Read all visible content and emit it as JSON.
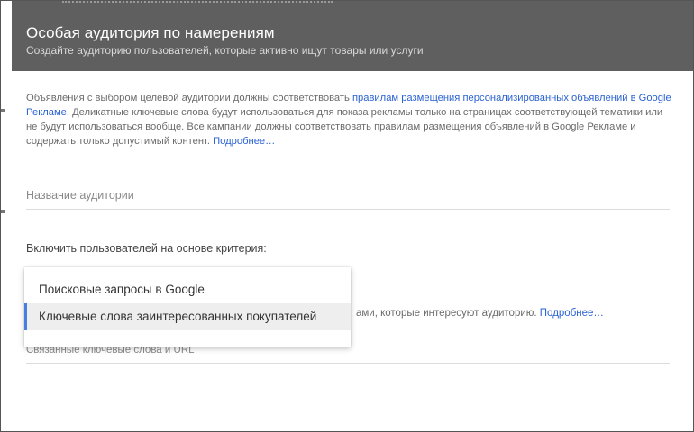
{
  "dialog": {
    "title": "Особая аудитория по намерениям",
    "subtitle": "Создайте аудиторию пользователей, которые активно ищут товары или услуги"
  },
  "notice": {
    "text_before_link": "Объявления с выбором целевой аудитории должны соответствовать ",
    "policy_link": "правилам размещения персонализированных объявлений в Google Рекламе",
    "text_after_link": ". Деликатные ключевые слова будут использоваться для показа рекламы только на страницах соответствующей тематики или не будут использоваться вообще. Все кампании должны соответствовать правилам размещения объявлений в Google Рекламе и содержать только допустимый контент. ",
    "more_link": "Подробнее…"
  },
  "audience_name": {
    "placeholder": "Название аудитории",
    "value": ""
  },
  "criteria": {
    "label": "Включить пользователей на основе критерия:",
    "options": [
      "Поисковые запросы в Google",
      "Ключевые слова заинтересованных покупателей"
    ],
    "selected_index": 1
  },
  "hint": {
    "text": "ами, которые интересуют аудиторию. ",
    "more_link": "Подробнее…"
  },
  "keywords_field": {
    "placeholder": "Связанные ключевые слова и URL",
    "value": ""
  },
  "colors": {
    "header_bg": "#5f5f5f",
    "link": "#2a62d3",
    "selected_accent": "#4a7ee0"
  }
}
